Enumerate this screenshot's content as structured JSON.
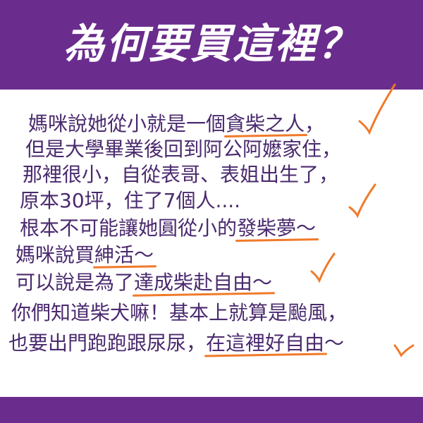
{
  "title": "為何要買這裡？",
  "lines": [
    {
      "pre": "媽咪說她從小就是一個",
      "mark": "貪柴之人",
      "post": "，"
    },
    {
      "pre": "但是大學畢業後回到阿公阿嬤家住，",
      "mark": "",
      "post": ""
    },
    {
      "pre": "那裡很小，自從表哥、表姐出生了，",
      "mark": "",
      "post": ""
    },
    {
      "pre": "原本30坪，住了7個人....",
      "mark": "",
      "post": ""
    },
    {
      "pre": "根本不可能讓她圓從小的",
      "mark": "發柴夢～",
      "post": ""
    },
    {
      "pre": "媽咪說買",
      "mark": "紳活～",
      "post": ""
    },
    {
      "pre": "可以說是為了",
      "mark": "達成柴赴自由～",
      "post": ""
    },
    {
      "pre": "你們知道柴犬嘛！基本上就算是颱風，",
      "mark": "",
      "post": ""
    },
    {
      "pre": "也要出門跑跑跟尿尿，",
      "mark": "在這裡好自由",
      "post": "～"
    }
  ],
  "colors": {
    "header": "#6a2c8d",
    "text": "#4a2a6e",
    "accent": "#f07a2a"
  }
}
